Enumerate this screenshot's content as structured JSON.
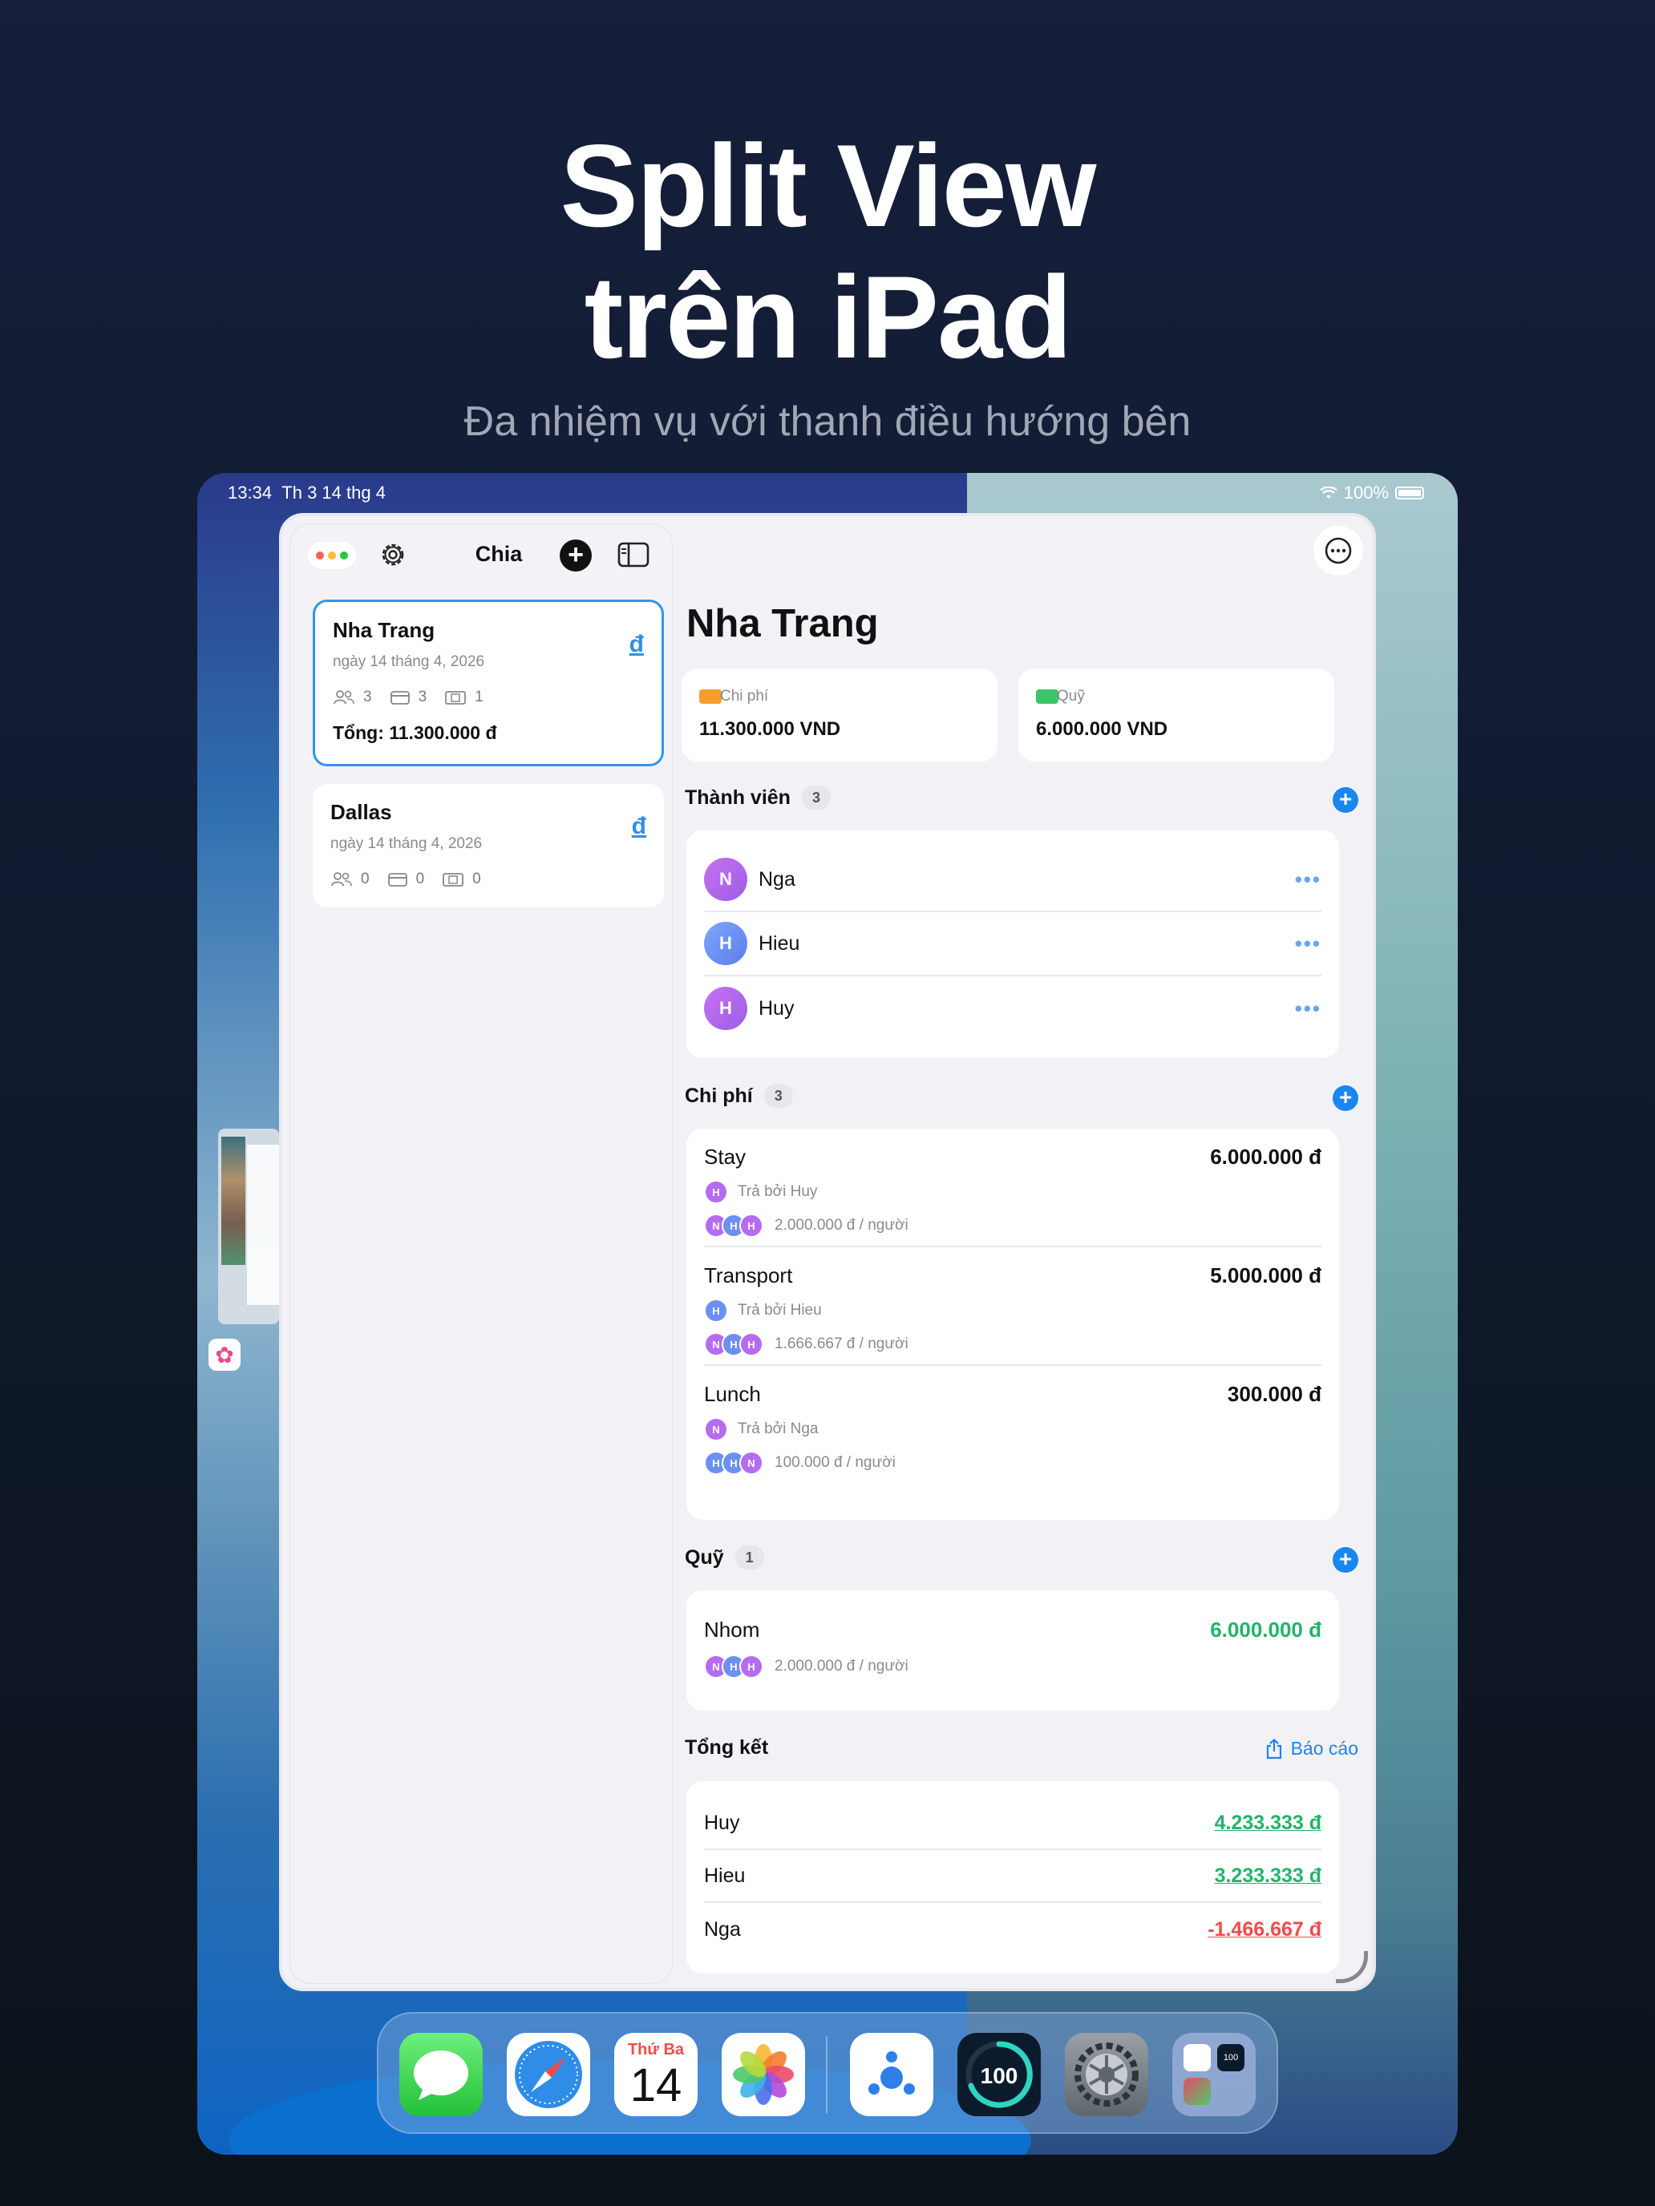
{
  "hero": {
    "title_line1": "Split View",
    "title_line2": "trên iPad",
    "subtitle": "Đa nhiệm vụ với thanh điều hướng bên"
  },
  "status_bar": {
    "time": "13:34",
    "date": "Th 3 14 thg 4",
    "battery": "100%"
  },
  "sidebar": {
    "title": "Chia",
    "trips": [
      {
        "name": "Nha Trang",
        "date": "ngày 14 tháng 4, 2026",
        "currency": "đ",
        "members": "3",
        "expenses": "3",
        "funds": "1",
        "total": "Tổng: 11.300.000 đ"
      },
      {
        "name": "Dallas",
        "date": "ngày 14 tháng 4, 2026",
        "currency": "đ",
        "members": "0",
        "expenses": "0",
        "funds": "0"
      }
    ]
  },
  "main": {
    "title": "Nha Trang",
    "tiles": {
      "expense": {
        "label": "Chi phí",
        "value": "11.300.000 VND"
      },
      "fund": {
        "label": "Quỹ",
        "value": "6.000.000 VND"
      }
    },
    "members_section": {
      "label": "Thành viên",
      "count": "3"
    },
    "members": [
      {
        "initial": "N",
        "name": "Nga",
        "more": "•••"
      },
      {
        "initial": "H",
        "name": "Hieu",
        "more": "•••"
      },
      {
        "initial": "H",
        "name": "Huy",
        "more": "•••"
      }
    ],
    "expenses_section": {
      "label": "Chi phí",
      "count": "3"
    },
    "expenses": [
      {
        "name": "Stay",
        "amount": "6.000.000 đ",
        "payer_initial": "H",
        "paid_by": "Trả bởi Huy",
        "share_initials": [
          "N",
          "H",
          "H"
        ],
        "per_person": "2.000.000 đ / người"
      },
      {
        "name": "Transport",
        "amount": "5.000.000 đ",
        "payer_initial": "H",
        "paid_by": "Trả bởi Hieu",
        "share_initials": [
          "N",
          "H",
          "H"
        ],
        "per_person": "1.666.667 đ / người"
      },
      {
        "name": "Lunch",
        "amount": "300.000 đ",
        "payer_initial": "N",
        "paid_by": "Trả bởi Nga",
        "share_initials": [
          "H",
          "H",
          "N"
        ],
        "per_person": "100.000 đ / người"
      }
    ],
    "funds_section": {
      "label": "Quỹ",
      "count": "1"
    },
    "fund": {
      "name": "Nhom",
      "amount": "6.000.000 đ",
      "share_initials": [
        "N",
        "H",
        "H"
      ],
      "per_person": "2.000.000 đ / người"
    },
    "summary_section": {
      "label": "Tổng kết",
      "report": "Báo cáo"
    },
    "summary": [
      {
        "name": "Huy",
        "amount": "4.233.333 đ"
      },
      {
        "name": "Hieu",
        "amount": "3.233.333 đ"
      },
      {
        "name": "Nga",
        "amount": "-1.466.667 đ"
      }
    ]
  },
  "dock": {
    "calendar_weekday": "Thứ Ba",
    "calendar_day": "14",
    "gauge_value": "100",
    "folder_badge": "100"
  },
  "colors": {
    "accent": "#1a86f0",
    "positive": "#23b36b",
    "negative": "#f04b4b",
    "selected_border": "#3295e8"
  }
}
